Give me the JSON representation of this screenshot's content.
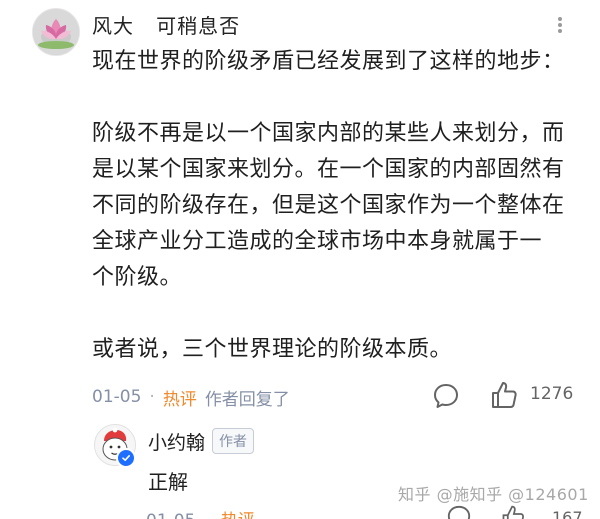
{
  "comment": {
    "author": "风大   可稍息否",
    "paragraphs": [
      [
        "现在世界的阶级矛盾已经发展到了这样的地步："
      ],
      [
        "阶级不再是以一个国家内部的某些人来划分，而",
        "是以某个国家来划分。在一个国家的内部固然有",
        "不同的阶级存在，但是这个国家作为一个整体在",
        "全球产业分工造成的全球市场中本身就属于一",
        "个阶级。"
      ],
      [
        "或者说，三个世界理论的阶级本质。"
      ]
    ],
    "line1": "现在世界的阶级矛盾已经发展到了这样的地步：",
    "line2": "阶级不再是以一个国家内部的某些人来划分，而",
    "line3": "是以某个国家来划分。在一个国家的内部固然有",
    "line4": "不同的阶级存在，但是这个国家作为一个整体在",
    "line5": "全球产业分工造成的全球市场中本身就属于一",
    "line6": "个阶级。",
    "line7": "或者说，三个世界理论的阶级本质。",
    "date": "01-05",
    "separator": "·",
    "hot_label": "热评",
    "author_replied": "作者回复了",
    "like_count": "1276"
  },
  "reply": {
    "author": "小约翰",
    "author_tag": "作者",
    "text": "正解",
    "date_partial": "01-05",
    "hot_partial": "热评",
    "like_count_partial": "167"
  },
  "watermark": "知乎 @施知乎 @124601",
  "icons": {
    "more": "more-options-icon",
    "reply": "comment-reply-icon",
    "like": "thumbs-up-icon",
    "verified": "verified-badge-icon"
  },
  "colors": {
    "hot": "#f08a2d",
    "meta": "#8590a6",
    "verified": "#1e6fff"
  }
}
